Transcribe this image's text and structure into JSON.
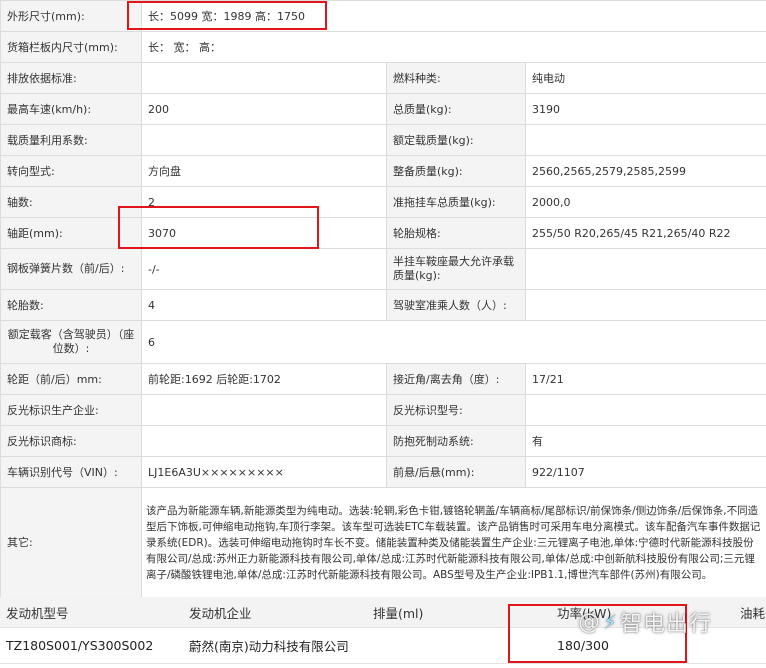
{
  "specs": {
    "r0": {
      "k1": "外形尺寸(mm):",
      "v1": "长：5099 宽：1989 高：1750"
    },
    "r1": {
      "k1": "货箱栏板内尺寸(mm):",
      "v1": "长：  宽：  高："
    },
    "r2": {
      "k1": "排放依据标准:",
      "v1": "",
      "k2": "燃料种类:",
      "v2": "纯电动"
    },
    "r3": {
      "k1": "最高车速(km/h):",
      "v1": "200",
      "k2": "总质量(kg):",
      "v2": "3190"
    },
    "r4": {
      "k1": "载质量利用系数:",
      "v1": "",
      "k2": "额定载质量(kg):",
      "v2": ""
    },
    "r5": {
      "k1": "转向型式:",
      "v1": "方向盘",
      "k2": "整备质量(kg):",
      "v2": "2560,2565,2579,2585,2599"
    },
    "r6": {
      "k1": "轴数:",
      "v1": "2",
      "k2": "准拖挂车总质量(kg):",
      "v2": "2000,0"
    },
    "r7": {
      "k1": "轴距(mm):",
      "v1": "3070",
      "k2": "轮胎规格:",
      "v2": "255/50 R20,265/45 R21,265/40 R22"
    },
    "r8": {
      "k1": "钢板弹簧片数（前/后）:",
      "v1": "-/-",
      "k2": "半挂车鞍座最大允许承载质量(kg):",
      "v2": ""
    },
    "r9": {
      "k1": "轮胎数:",
      "v1": "4",
      "k2": "驾驶室准乘人数（人）:",
      "v2": ""
    },
    "r10": {
      "k1": "额定载客（含驾驶员）（座位数）:",
      "v1": "6"
    },
    "r11": {
      "k1": "轮距（前/后）mm:",
      "v1": "前轮距:1692 后轮距:1702",
      "k2": "接近角/离去角（度）:",
      "v2": "17/21"
    },
    "r12": {
      "k1": "反光标识生产企业:",
      "v1": "",
      "k2": "反光标识型号:",
      "v2": ""
    },
    "r13": {
      "k1": "反光标识商标:",
      "v1": "",
      "k2": "防抱死制动系统:",
      "v2": "有"
    },
    "r14": {
      "k1": "车辆识别代号（VIN）:",
      "v1": "LJ1E6A3U×××××××××",
      "k2": "前悬/后悬(mm):",
      "v2": "922/1107"
    },
    "r15": {
      "k1": "其它:",
      "v1": "该产品为新能源车辆,新能源类型为纯电动。选装:轮辋,彩色卡钳,镀铬轮辋盖/车辆商标/尾部标识/前保饰条/侧边饰条/后保饰条,不同造型后下饰板,可伸缩电动拖钩,车顶行李架。该车型可选装ETC车载装置。该产品销售时可采用车电分离模式。该车配备汽车事件数据记录系统(EDR)。选装可伸缩电动拖钩时车长不变。储能装置种类及储能装置生产企业:三元锂离子电池,单体:宁德时代新能源科技股份有限公司/总成:苏州正力新能源科技有限公司,单体/总成:江苏时代新能源科技有限公司,单体/总成:中创新航科技股份有限公司;三元锂离子/磷酸铁锂电池,单体/总成:江苏时代新能源科技有限公司。ABS型号及生产企业:IPB1.1,博世汽车部件(苏州)有限公司。"
    }
  },
  "engine": {
    "headers": [
      "发动机型号",
      "发动机企业",
      "排量(ml)",
      "功率(kW)",
      "油耗"
    ],
    "row": [
      "TZ180S001/YS300S002",
      "蔚然(南京)动力科技有限公司",
      "",
      "180/300",
      ""
    ]
  },
  "watermark": {
    "text": "智电出行",
    "prefix": "@"
  },
  "colors": {
    "highlight": "#e0161b",
    "label_bg": "#f4f4f4",
    "border": "#dcdcdc"
  }
}
